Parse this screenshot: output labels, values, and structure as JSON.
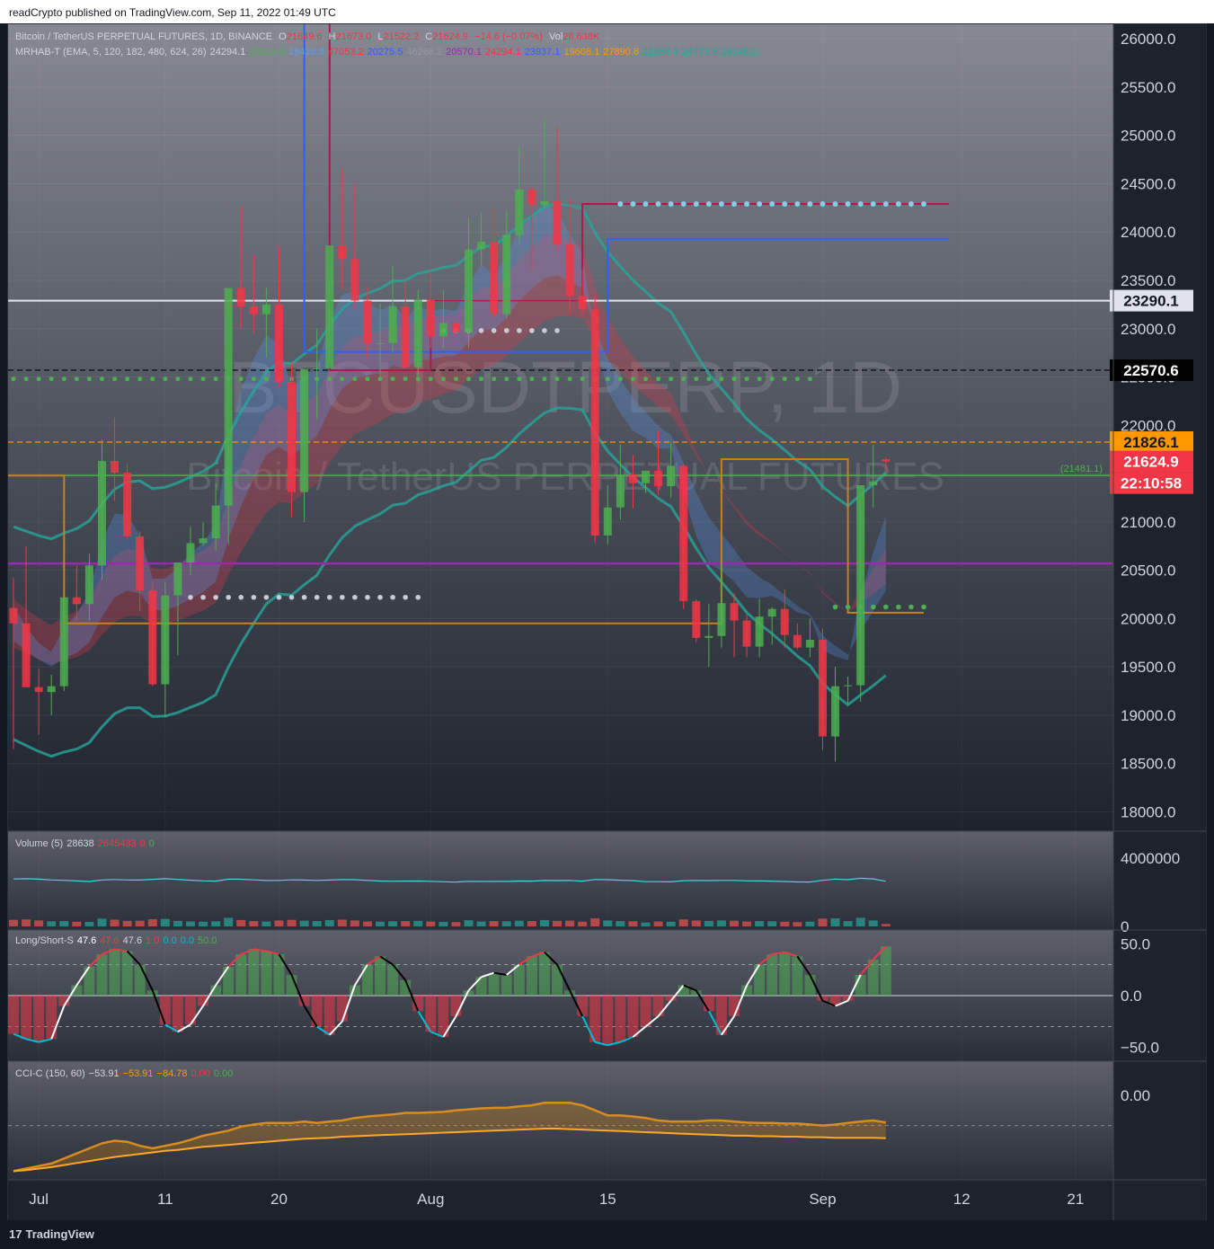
{
  "header": {
    "published": "readCrypto published on TradingView.com, Sep 11, 2022 01:49 UTC"
  },
  "footer": {
    "brand": "TradingView",
    "brand_mark": "17"
  },
  "watermark": {
    "line1": "BTCUSDTPERP, 1D",
    "line2": "Bitcoin / TetherUS PERPETUAL FUTURES"
  },
  "legend_main": {
    "symbol": "Bitcoin / TetherUS PERPETUAL FUTURES, 1D, BINANCE",
    "o_label": "O",
    "o": "21649.6",
    "h_label": "H",
    "h": "21673.0",
    "l_label": "L",
    "l": "21522.2",
    "c_label": "C",
    "c": "21624.9",
    "chg": "−14.6 (−0.07%)",
    "vol_label": "Vol",
    "vol": "28.638K"
  },
  "legend_ind": {
    "name": "MRHAB-T (EMA, 5, 120, 182, 480, 624, 26)",
    "values": [
      {
        "v": "24294.1",
        "c": "#d1d4dc"
      },
      {
        "v": "20122.5",
        "c": "#4caf50"
      },
      {
        "v": "18428.8",
        "c": "#5b9cf6"
      },
      {
        "v": "47053.2",
        "c": "#f23645"
      },
      {
        "v": "20275.5",
        "c": "#2962ff"
      },
      {
        "v": "46266.2",
        "c": "#9598a1"
      },
      {
        "v": "20570.1",
        "c": "#9c27b0"
      },
      {
        "v": "24294.1",
        "c": "#f23645"
      },
      {
        "v": "23937.1",
        "c": "#2962ff"
      },
      {
        "v": "19608.1",
        "c": "#ff9800"
      },
      {
        "v": "27890.8",
        "c": "#ff9800"
      },
      {
        "v": "21958.4",
        "c": "#26a69a"
      },
      {
        "v": "24773.6",
        "c": "#26a69a"
      },
      {
        "v": "19148.2",
        "c": "#26a69a"
      }
    ]
  },
  "price_axis": {
    "ticks": [
      "26000.0",
      "25500.0",
      "25000.0",
      "24500.0",
      "24000.0",
      "23500.0",
      "23000.0",
      "22500.0",
      "22000.0",
      "21500.0",
      "21000.0",
      "20500.0",
      "20000.0",
      "19500.0",
      "19000.0",
      "18500.0",
      "18000.0"
    ],
    "labels": [
      {
        "text": "23290.1",
        "value": 23290.1,
        "bg": "#e0e3eb",
        "fg": "#131722"
      },
      {
        "text": "22570.6",
        "value": 22570.6,
        "bg": "#000000",
        "fg": "#ffffff"
      },
      {
        "text": "21826.1",
        "value": 21826.1,
        "bg": "#ff9800",
        "fg": "#131722"
      },
      {
        "text": "21624.9",
        "value": 21624.9,
        "bg": "#f23645",
        "fg": "#ffffff"
      },
      {
        "text": "22:10:58",
        "value": 21624.9,
        "bg": "#f23645",
        "fg": "#ffffff"
      }
    ],
    "line_label": "(21481.1)"
  },
  "volume_pane": {
    "title": "Volume (5)",
    "values": [
      {
        "v": "28638",
        "c": "#d1d4dc"
      },
      {
        "v": "2645433",
        "c": "#f23645"
      },
      {
        "v": "0",
        "c": "#f23645"
      },
      {
        "v": "0",
        "c": "#4caf50"
      }
    ],
    "ticks": [
      "4000000",
      "0"
    ]
  },
  "ls_pane": {
    "title": "Long/Short-S",
    "values": [
      {
        "v": "47.6",
        "c": "#ffffff"
      },
      {
        "v": "47.6",
        "c": "#f23645"
      },
      {
        "v": "47.6",
        "c": "#d1d4dc"
      },
      {
        "v": "1.0",
        "c": "#f23645"
      },
      {
        "v": "0.0",
        "c": "#00bcd4"
      },
      {
        "v": "0.0",
        "c": "#00bcd4"
      },
      {
        "v": "50.0",
        "c": "#4caf50"
      }
    ],
    "ticks": [
      "50.0",
      "0.0",
      "−50.0"
    ]
  },
  "cci_pane": {
    "title": "CCI-C (150, 60)",
    "values": [
      {
        "v": "−53.91",
        "c": "#d1d4dc"
      },
      {
        "v": "−53.91",
        "c": "#ff9800"
      },
      {
        "v": "−84.78",
        "c": "#ff9800"
      },
      {
        "v": "0.00",
        "c": "#f23645"
      },
      {
        "v": "0.00",
        "c": "#4caf50"
      }
    ],
    "ticks": [
      "0.00"
    ]
  },
  "time_axis": {
    "labels": [
      "Jul",
      "11",
      "20",
      "Aug",
      "15",
      "Sep",
      "12",
      "21"
    ]
  },
  "chart_data": {
    "type": "candlestick",
    "title": "Bitcoin / TetherUS PERPETUAL FUTURES, 1D, BINANCE",
    "ylim": [
      17800,
      26150
    ],
    "start_date": "2022-06-29",
    "candles": [
      [
        20110,
        20420,
        18650,
        19950
      ],
      [
        19950,
        20750,
        19350,
        19290
      ],
      [
        19290,
        19480,
        18800,
        19240
      ],
      [
        19240,
        19420,
        19000,
        19300
      ],
      [
        19300,
        20060,
        19250,
        20220
      ],
      [
        20220,
        20550,
        19980,
        20150
      ],
      [
        20150,
        20670,
        19980,
        20550
      ],
      [
        20550,
        21850,
        20400,
        21630
      ],
      [
        21630,
        22080,
        21220,
        21510
      ],
      [
        21510,
        21600,
        20820,
        20850
      ],
      [
        20850,
        20900,
        20080,
        20290
      ],
      [
        20290,
        20370,
        19300,
        19320
      ],
      [
        19320,
        20380,
        18980,
        20240
      ],
      [
        20240,
        20400,
        19620,
        20580
      ],
      [
        20580,
        20950,
        20450,
        20780
      ],
      [
        20780,
        21000,
        20750,
        20830
      ],
      [
        20830,
        21400,
        20700,
        21170
      ],
      [
        21170,
        22650,
        20770,
        23420
      ],
      [
        23420,
        24270,
        23010,
        23230
      ],
      [
        23230,
        23760,
        22950,
        23150
      ],
      [
        23150,
        23420,
        22700,
        23250
      ],
      [
        23250,
        23850,
        22400,
        22450
      ],
      [
        22450,
        22650,
        21050,
        21310
      ],
      [
        21310,
        22450,
        21000,
        22580
      ],
      [
        22580,
        23000,
        22070,
        22590
      ],
      [
        22590,
        23500,
        22650,
        23860
      ],
      [
        23860,
        24660,
        23400,
        23720
      ],
      [
        23720,
        24500,
        23200,
        23290
      ],
      [
        23290,
        23440,
        22700,
        22850
      ],
      [
        22850,
        23260,
        22500,
        22850
      ],
      [
        22850,
        23650,
        22750,
        23230
      ],
      [
        23230,
        23500,
        22600,
        22600
      ],
      [
        22600,
        23400,
        22450,
        23300
      ],
      [
        23300,
        23600,
        22800,
        22920
      ],
      [
        22920,
        23400,
        22800,
        23060
      ],
      [
        23060,
        23200,
        22850,
        22960
      ],
      [
        22960,
        24150,
        22800,
        23820
      ],
      [
        23820,
        24200,
        23650,
        23900
      ],
      [
        23900,
        24250,
        23120,
        23150
      ],
      [
        23150,
        24230,
        23100,
        23970
      ],
      [
        23970,
        24890,
        23880,
        24440
      ],
      [
        24440,
        24470,
        23600,
        24280
      ],
      [
        24280,
        25180,
        24260,
        24320
      ],
      [
        24320,
        25080,
        23800,
        23870
      ],
      [
        23870,
        24350,
        23150,
        23340
      ],
      [
        23340,
        23620,
        23140,
        23200
      ],
      [
        23200,
        23350,
        20780,
        20860
      ],
      [
        20860,
        21380,
        20770,
        21150
      ],
      [
        21150,
        21800,
        21020,
        21490
      ],
      [
        21490,
        21690,
        21140,
        21400
      ],
      [
        21400,
        21500,
        21300,
        21530
      ],
      [
        21530,
        21950,
        21280,
        21370
      ],
      [
        21370,
        21820,
        21250,
        21580
      ],
      [
        21580,
        21600,
        20100,
        20180
      ],
      [
        20180,
        20200,
        19750,
        19800
      ],
      [
        19800,
        20150,
        19500,
        19820
      ],
      [
        19820,
        20570,
        19700,
        20160
      ],
      [
        20160,
        20260,
        19600,
        19980
      ],
      [
        19980,
        20040,
        19600,
        19710
      ],
      [
        19710,
        20200,
        19600,
        20020
      ],
      [
        20020,
        20120,
        19730,
        20100
      ],
      [
        20100,
        20300,
        19700,
        19830
      ],
      [
        19830,
        19950,
        19680,
        19700
      ],
      [
        19700,
        20000,
        19600,
        19780
      ],
      [
        19780,
        19900,
        18640,
        18780
      ],
      [
        18780,
        19500,
        18520,
        19300
      ],
      [
        19300,
        19400,
        19110,
        19310
      ],
      [
        19310,
        21230,
        19140,
        21380
      ],
      [
        21380,
        21800,
        21150,
        21420
      ],
      [
        21649.6,
        21673.0,
        21522.2,
        21624.9
      ]
    ],
    "volume_max": 5200000,
    "volume": [
      3.2,
      3.4,
      2.9,
      2.5,
      2.6,
      2.3,
      2.2,
      3.8,
      3.3,
      2.7,
      2.8,
      3.5,
      3.6,
      2.7,
      2.4,
      2.3,
      2.5,
      4.2,
      3.1,
      2.6,
      2.4,
      2.9,
      3.2,
      2.8,
      2.6,
      3.1,
      3.3,
      2.9,
      2.4,
      2.3,
      2.5,
      2.6,
      2.7,
      2.4,
      2.2,
      2.1,
      3.0,
      2.4,
      2.6,
      2.5,
      2.8,
      2.6,
      3.1,
      2.7,
      2.8,
      2.3,
      3.9,
      2.9,
      2.6,
      2.5,
      1.9,
      2.4,
      2.3,
      3.4,
      2.9,
      2.7,
      2.9,
      2.8,
      2.4,
      2.6,
      2.5,
      2.3,
      2.1,
      2.3,
      3.8,
      3.9,
      2.6,
      4.2,
      2.9,
      1.2
    ],
    "ls_values": [
      -37,
      -42,
      -45,
      -42,
      -10,
      10,
      28,
      40,
      45,
      43,
      30,
      5,
      -28,
      -35,
      -28,
      -10,
      10,
      28,
      40,
      45,
      43,
      40,
      20,
      -10,
      -30,
      -38,
      -25,
      10,
      30,
      38,
      30,
      15,
      -15,
      -35,
      -40,
      -20,
      5,
      18,
      22,
      20,
      30,
      38,
      42,
      30,
      5,
      -20,
      -45,
      -48,
      -45,
      -40,
      -30,
      -20,
      -5,
      10,
      5,
      -15,
      -38,
      -20,
      10,
      30,
      40,
      42,
      38,
      20,
      -5,
      -10,
      -5,
      20,
      35,
      47.6
    ],
    "cci_line": [
      -150,
      -145,
      -140,
      -135,
      -125,
      -115,
      -105,
      -95,
      -90,
      -92,
      -100,
      -105,
      -100,
      -95,
      -88,
      -80,
      -75,
      -70,
      -62,
      -58,
      -55,
      -55,
      -55,
      -52,
      -55,
      -52,
      -50,
      -45,
      -42,
      -40,
      -38,
      -35,
      -35,
      -34,
      -33,
      -30,
      -28,
      -26,
      -25,
      -25,
      -22,
      -20,
      -15,
      -15,
      -15,
      -20,
      -30,
      -40,
      -40,
      -42,
      -45,
      -50,
      -52,
      -52,
      -52,
      -50,
      -50,
      -52,
      -54,
      -55,
      -55,
      -56,
      -56,
      -58,
      -60,
      -58,
      -55,
      -52,
      -50,
      -53.91
    ],
    "cci_signal": [
      -150,
      -148,
      -145,
      -142,
      -138,
      -134,
      -130,
      -126,
      -122,
      -119,
      -116,
      -113,
      -110,
      -108,
      -105,
      -102,
      -100,
      -98,
      -96,
      -94,
      -92,
      -90,
      -88,
      -86,
      -85,
      -84,
      -82,
      -81,
      -80,
      -79,
      -78,
      -77,
      -76,
      -75,
      -74,
      -73,
      -72,
      -71,
      -70,
      -69,
      -68,
      -67,
      -66,
      -66,
      -67,
      -68,
      -69,
      -70,
      -71,
      -72,
      -73,
      -74,
      -75,
      -76,
      -77,
      -78,
      -79,
      -80,
      -80,
      -81,
      -81,
      -82,
      -82,
      -83,
      -83,
      -84,
      -84,
      -84,
      -84,
      -84.78
    ],
    "cci_ylim": [
      -160,
      60
    ],
    "ls_ylim": [
      -60,
      60
    ]
  },
  "colors": {
    "up": "#4caf50",
    "down": "#f23645",
    "bg": "#1e222d",
    "grid": "#2a2e39",
    "text": "#d1d4dc"
  }
}
